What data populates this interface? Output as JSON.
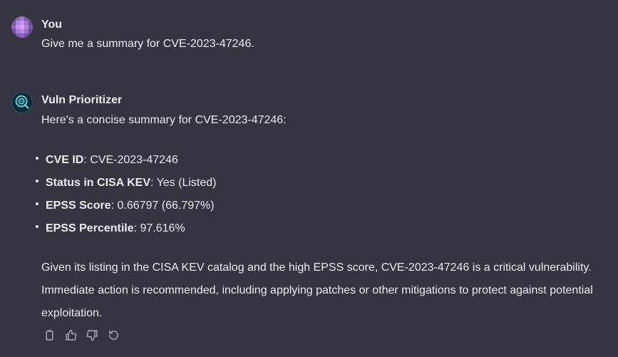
{
  "user_message": {
    "author": "You",
    "text": "Give me a summary for CVE-2023-47246."
  },
  "assistant_message": {
    "author": "Vuln Prioritizer",
    "intro": "Here's a concise summary for CVE-2023-47246:",
    "facts": [
      {
        "label": "CVE ID",
        "value": ": CVE-2023-47246"
      },
      {
        "label": "Status in CISA KEV",
        "value": ": Yes (Listed)"
      },
      {
        "label": "EPSS Score",
        "value": ": 0.66797 (66.797%)"
      },
      {
        "label": "EPSS Percentile",
        "value": ": 97.616%"
      }
    ],
    "conclusion": "Given its listing in the CISA KEV catalog and the high EPSS score, CVE-2023-47246 is a critical vulnerability. Immediate action is recommended, including applying patches or other mitigations to protect against potential exploitation."
  },
  "actions": [
    {
      "icon": "copy-icon"
    },
    {
      "icon": "thumbs-up-icon"
    },
    {
      "icon": "thumbs-down-icon"
    },
    {
      "icon": "regenerate-icon"
    }
  ],
  "colors": {
    "background": "#343541",
    "text": "#ececf1",
    "icon": "#acacbe"
  }
}
